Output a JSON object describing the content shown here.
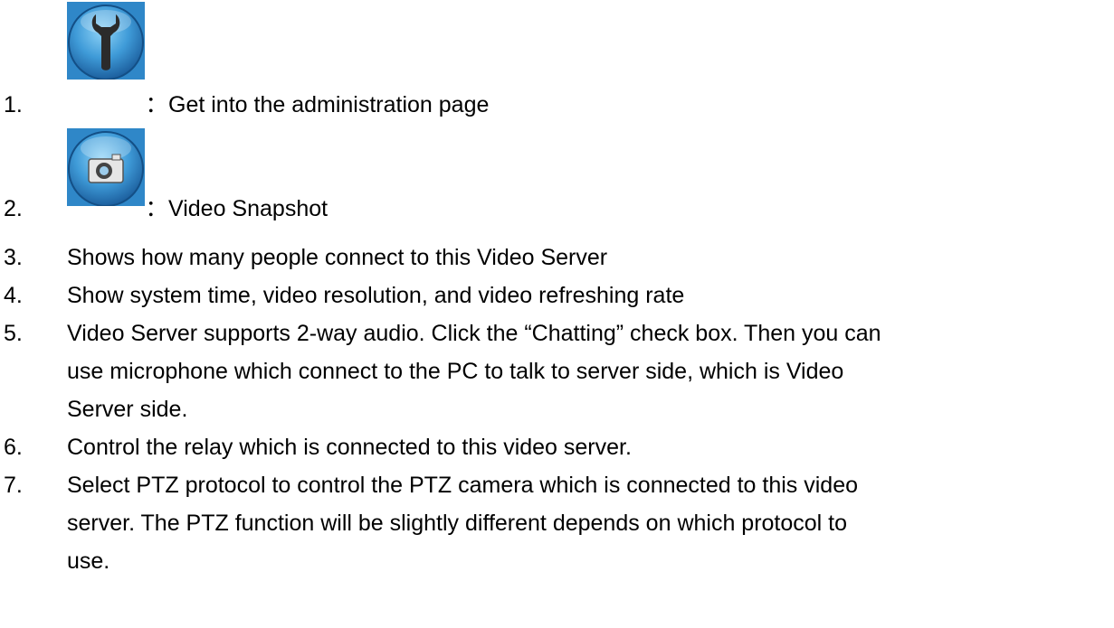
{
  "items": [
    {
      "number": "1.",
      "icon": "wrench-icon",
      "label": "Get into the administration page"
    },
    {
      "number": "2.",
      "icon": "camera-icon",
      "label": "Video Snapshot"
    },
    {
      "number": "3.",
      "lines": [
        "Shows how many people connect to this Video Server"
      ]
    },
    {
      "number": "4.",
      "lines": [
        "Show system time, video resolution, and video refreshing rate"
      ]
    },
    {
      "number": "5.",
      "lines": [
        "Video Server supports 2-way audio. Click the “Chatting” check box. Then you can",
        "use microphone which connect to the PC to talk to server side, which is Video",
        "Server side."
      ]
    },
    {
      "number": "6.",
      "lines": [
        "Control the relay which is connected to this video server."
      ]
    },
    {
      "number": "7.",
      "lines": [
        "Select PTZ protocol to control the PTZ camera which is connected to this video",
        "server. The PTZ function will be slightly different depends on which protocol to",
        "use."
      ]
    }
  ],
  "separator": "："
}
